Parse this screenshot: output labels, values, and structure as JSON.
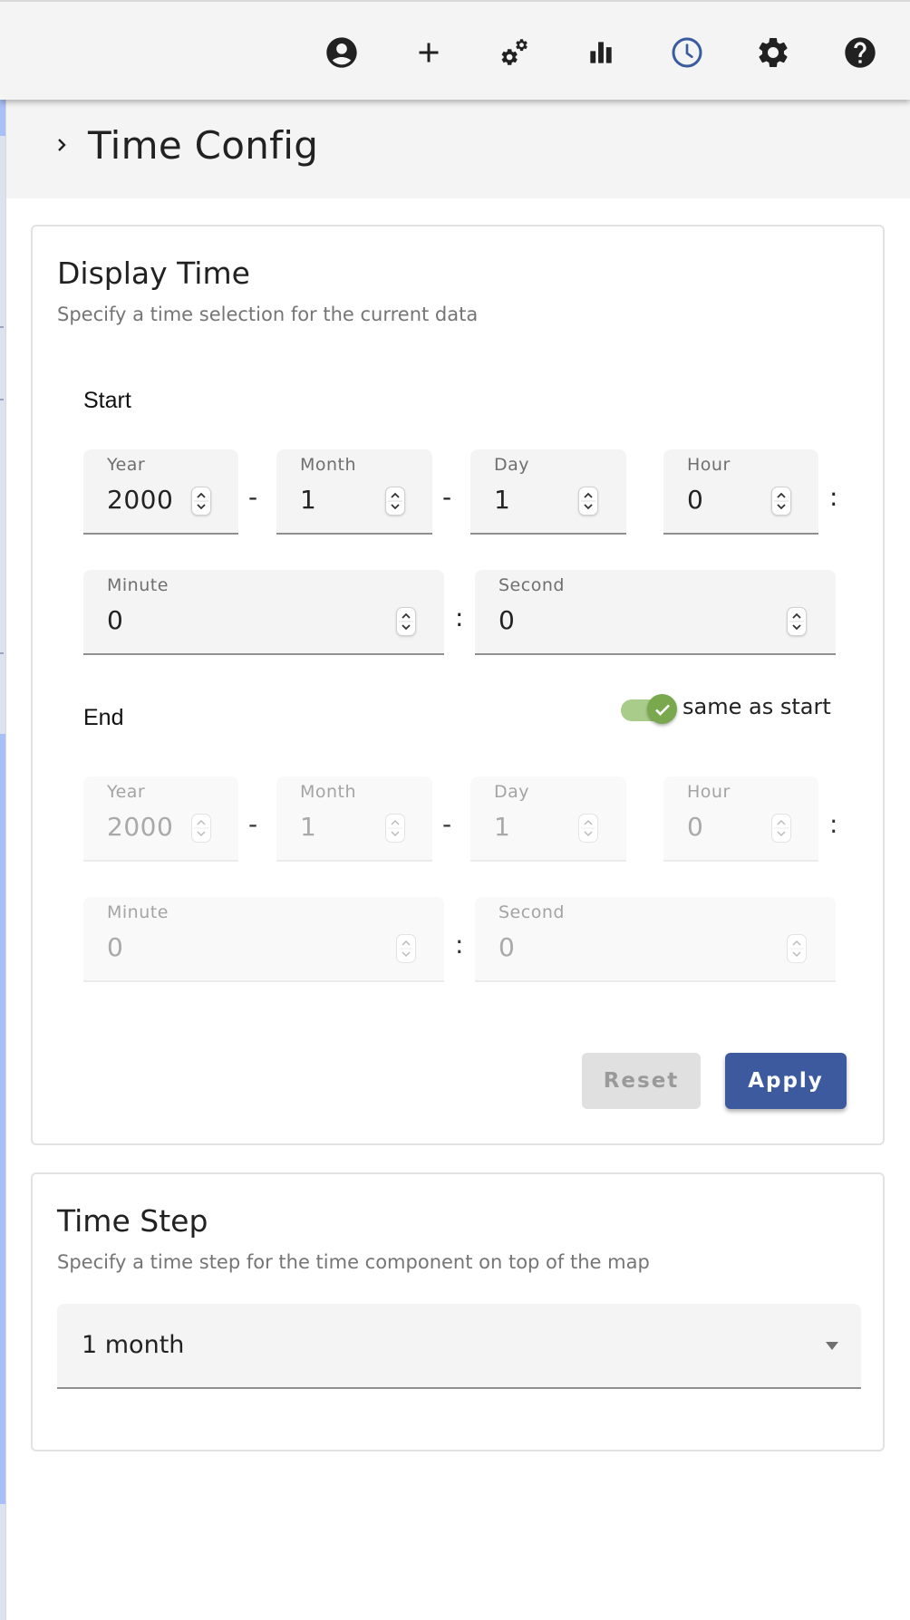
{
  "toolbar": {
    "icons": [
      {
        "name": "account-circle-icon",
        "label": "Account"
      },
      {
        "name": "plus-icon",
        "label": "Add"
      },
      {
        "name": "cogs-icon",
        "label": "Configuration"
      },
      {
        "name": "bar-chart-icon",
        "label": "Charts"
      },
      {
        "name": "clock-icon",
        "label": "Time",
        "active": true
      },
      {
        "name": "gear-icon",
        "label": "Settings"
      },
      {
        "name": "help-icon",
        "label": "Help"
      }
    ],
    "active_color": "#3a5ba0"
  },
  "section": {
    "title": "Time Config"
  },
  "display_time": {
    "title": "Display Time",
    "subtitle": "Specify a time selection for the current data",
    "start": {
      "label": "Start",
      "year": {
        "label": "Year",
        "value": "2000"
      },
      "month": {
        "label": "Month",
        "value": "1"
      },
      "day": {
        "label": "Day",
        "value": "1"
      },
      "hour": {
        "label": "Hour",
        "value": "0"
      },
      "minute": {
        "label": "Minute",
        "value": "0"
      },
      "second": {
        "label": "Second",
        "value": "0"
      }
    },
    "end": {
      "label": "End",
      "same_as_start_label": "same as start",
      "same_as_start": true,
      "year": {
        "label": "Year",
        "value": "2000"
      },
      "month": {
        "label": "Month",
        "value": "1"
      },
      "day": {
        "label": "Day",
        "value": "1"
      },
      "hour": {
        "label": "Hour",
        "value": "0"
      },
      "minute": {
        "label": "Minute",
        "value": "0"
      },
      "second": {
        "label": "Second",
        "value": "0"
      }
    },
    "separators": {
      "date": "-",
      "time": ":"
    },
    "reset_label": "Reset",
    "apply_label": "Apply"
  },
  "time_step": {
    "title": "Time Step",
    "subtitle": "Specify a time step for the time component on top of the map",
    "selected": "1 month"
  },
  "colors": {
    "accent": "#3d5a9e",
    "toggle_on": "#7aa84f"
  }
}
